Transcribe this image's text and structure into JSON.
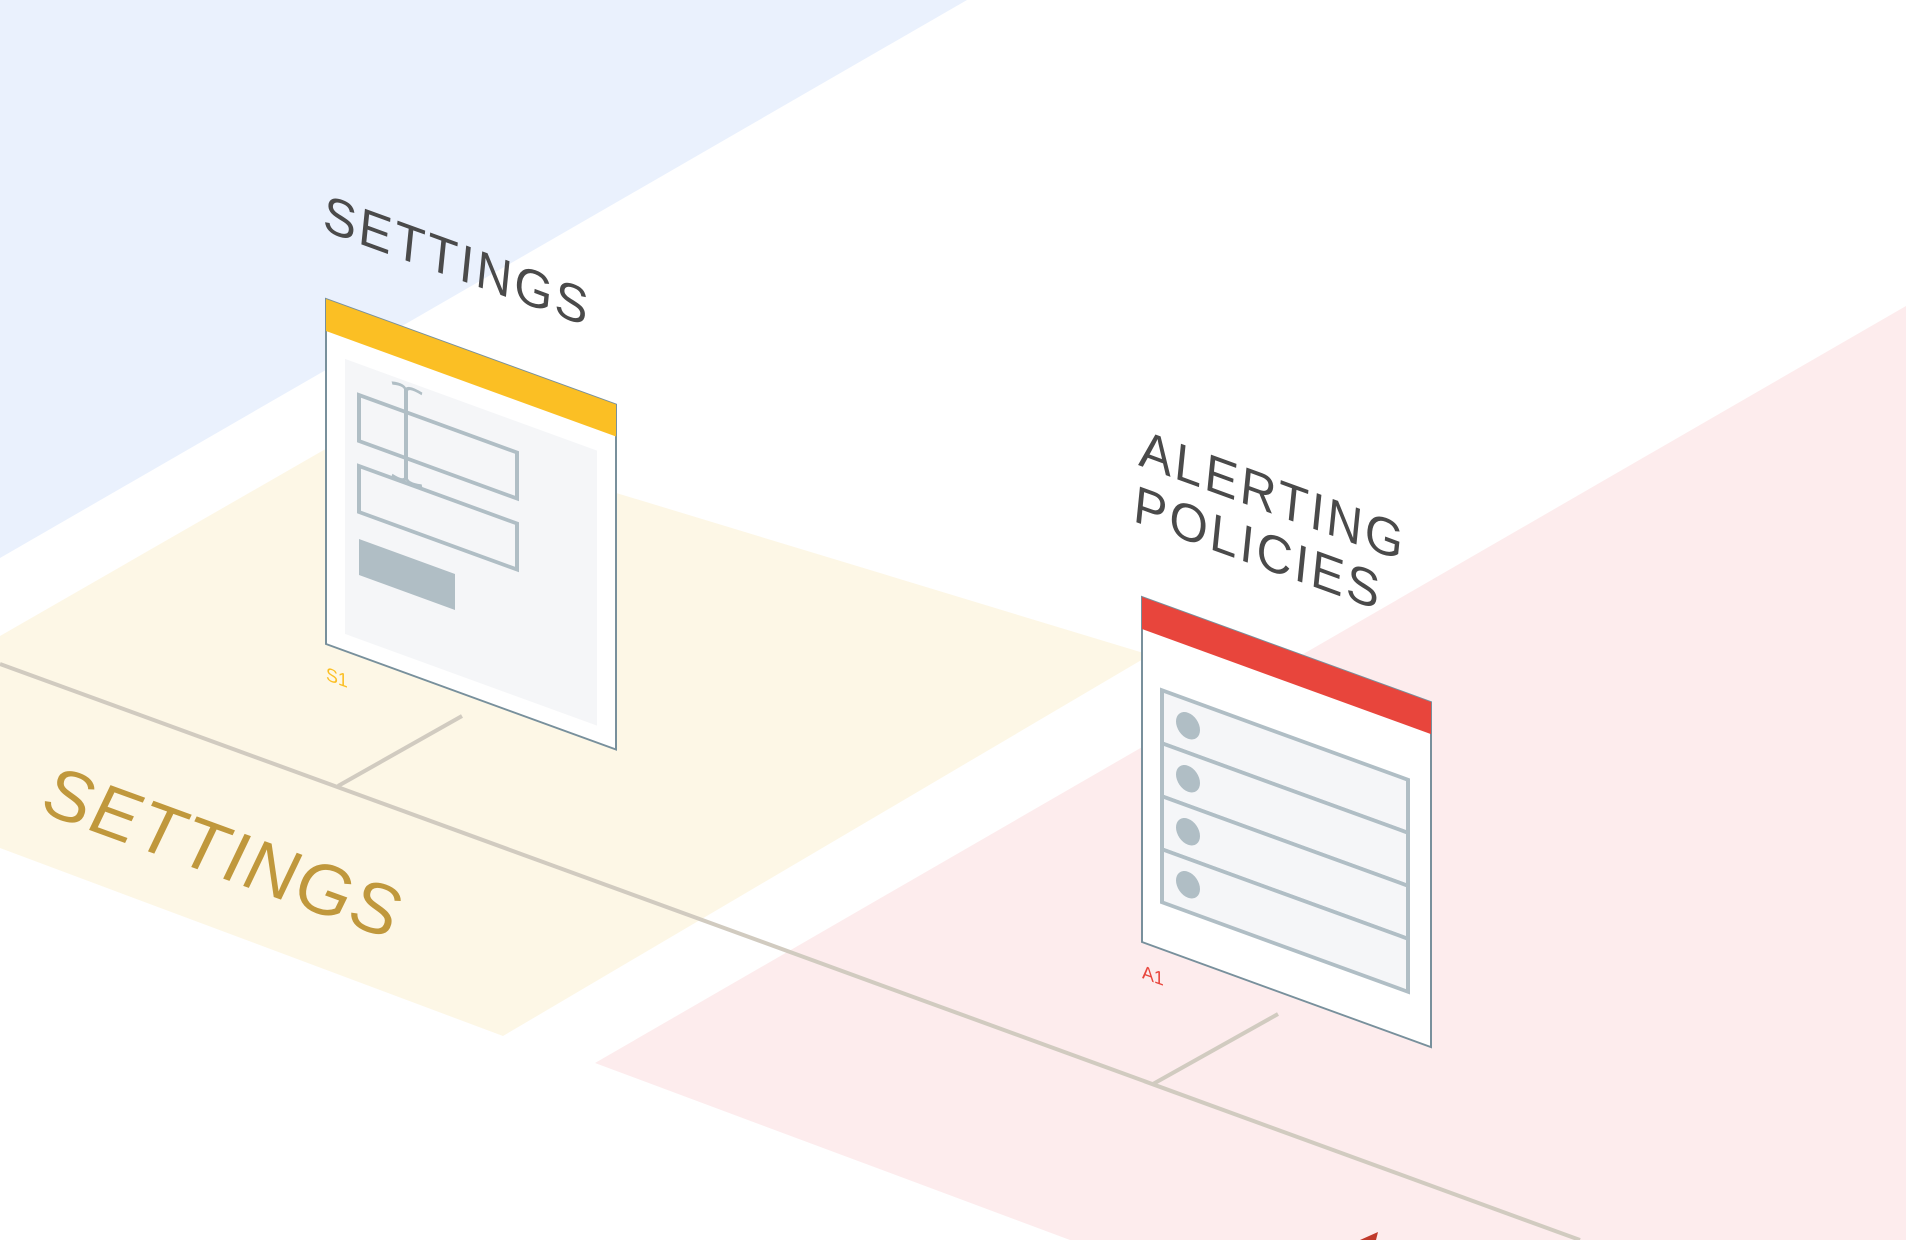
{
  "colors": {
    "background": "#ffffff",
    "blue_zone": "#eaf1fd",
    "yellow_zone": "#fdf7e6",
    "red_zone": "#fdeced",
    "settings_accent": "#fbbf24",
    "settings_zone_label": "#c0983c",
    "alerting_accent": "#e8453c",
    "wireframe_stroke": "#b0bec5",
    "wireframe_fill": "#f5f6f8",
    "page_outline": "#78909c",
    "connector": "#d1cbc0",
    "title_text": "#4a4a4a"
  },
  "zones": [
    {
      "name": "blue-zone",
      "color": "#eaf1fd"
    },
    {
      "name": "settings-zone",
      "color": "#fdf7e6",
      "label": "SETTINGS"
    },
    {
      "name": "alerting-zone",
      "color": "#fdeced"
    }
  ],
  "pages": [
    {
      "id": "settings",
      "title_lines": [
        "SETTINGS"
      ],
      "code": "S1",
      "accent": "#fbbf24",
      "content_icon": "form-wireframe-icon"
    },
    {
      "id": "alerting-policies",
      "title_lines": [
        "ALERTING",
        "POLICIES"
      ],
      "code": "A1",
      "accent": "#e8453c",
      "content_icon": "list-wireframe-icon"
    }
  ]
}
